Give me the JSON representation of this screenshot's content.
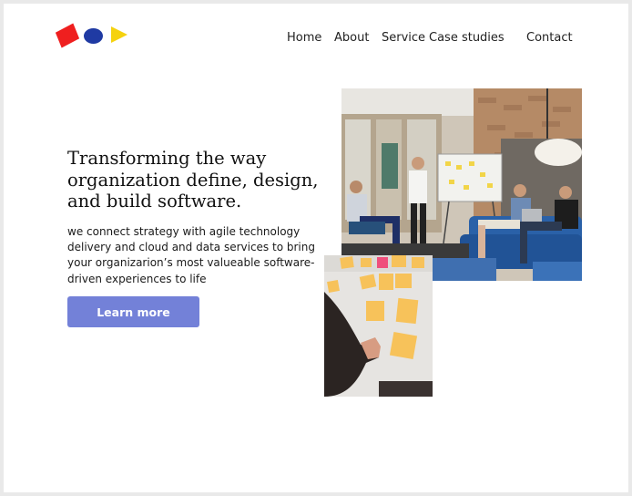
{
  "header": {
    "nav": [
      "Home",
      "About",
      "Service",
      "Case studies",
      "Contact"
    ]
  },
  "hero": {
    "title_lines": [
      "Transforming the way",
      "organization define, design,",
      "and build software."
    ],
    "description_lines": [
      "we connect strategy with agile technology",
      "delivery and cloud and data services to bring",
      "your organizarion’s most valueable software-",
      "driven experiences to life"
    ],
    "cta_label": "Learn more"
  },
  "colors": {
    "logo_red": "#ef1f1f",
    "logo_blue": "#1f3aa3",
    "logo_yellow": "#f5d20f",
    "cta_background": "#7381d8"
  },
  "images": {
    "office": "office-team-meeting-photo",
    "sticky_notes": "sticky-notes-wall-photo"
  }
}
